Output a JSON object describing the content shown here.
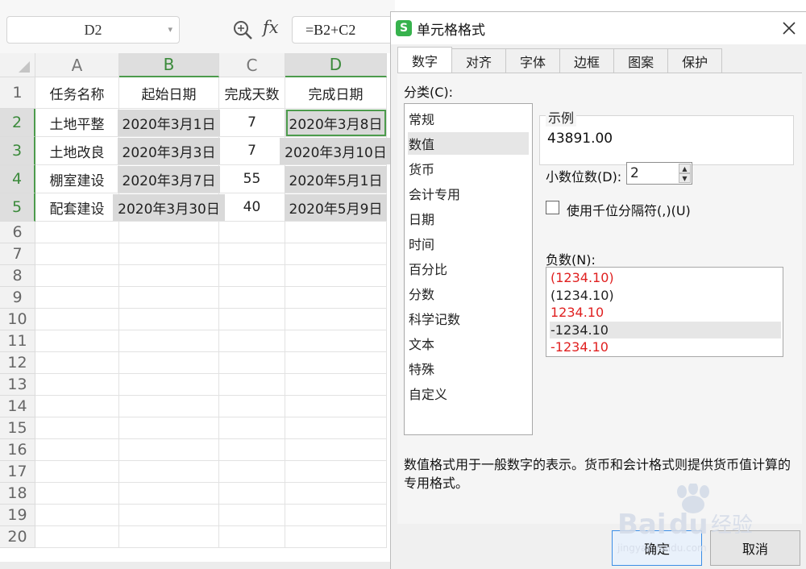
{
  "formula_bar": {
    "name_box": "D2",
    "zoom_icon": "zoom-icon",
    "fx_label": "fx",
    "formula": "=B2+C2"
  },
  "sheet": {
    "columns": [
      "A",
      "B",
      "C",
      "D"
    ],
    "selected_column": "D",
    "rows": [
      {
        "num": "1",
        "cells": [
          "任务名称",
          "起始日期",
          "完成天数",
          "完成日期"
        ]
      },
      {
        "num": "2",
        "cells": [
          "土地平整",
          "2020年3月1日",
          "7",
          "2020年3月8日"
        ]
      },
      {
        "num": "3",
        "cells": [
          "土地改良",
          "2020年3月3日",
          "7",
          "2020年3月10日"
        ]
      },
      {
        "num": "4",
        "cells": [
          "棚室建设",
          "2020年3月7日",
          "55",
          "2020年5月1日"
        ]
      },
      {
        "num": "5",
        "cells": [
          "配套建设",
          "2020年3月30日",
          "40",
          "2020年5月9日"
        ]
      },
      {
        "num": "6",
        "cells": [
          "",
          "",
          "",
          ""
        ]
      },
      {
        "num": "7",
        "cells": [
          "",
          "",
          "",
          ""
        ]
      },
      {
        "num": "8",
        "cells": [
          "",
          "",
          "",
          ""
        ]
      },
      {
        "num": "9",
        "cells": [
          "",
          "",
          "",
          ""
        ]
      },
      {
        "num": "10",
        "cells": [
          "",
          "",
          "",
          ""
        ]
      },
      {
        "num": "11",
        "cells": [
          "",
          "",
          "",
          ""
        ]
      },
      {
        "num": "12",
        "cells": [
          "",
          "",
          "",
          ""
        ]
      },
      {
        "num": "13",
        "cells": [
          "",
          "",
          "",
          ""
        ]
      },
      {
        "num": "14",
        "cells": [
          "",
          "",
          "",
          ""
        ]
      },
      {
        "num": "15",
        "cells": [
          "",
          "",
          "",
          ""
        ]
      },
      {
        "num": "16",
        "cells": [
          "",
          "",
          "",
          ""
        ]
      },
      {
        "num": "17",
        "cells": [
          "",
          "",
          "",
          ""
        ]
      },
      {
        "num": "18",
        "cells": [
          "",
          "",
          "",
          ""
        ]
      },
      {
        "num": "19",
        "cells": [
          "",
          "",
          "",
          ""
        ]
      },
      {
        "num": "20",
        "cells": [
          "",
          "",
          "",
          ""
        ]
      }
    ]
  },
  "dialog": {
    "title": "单元格格式",
    "app_icon_letter": "S",
    "tabs": [
      "数字",
      "对齐",
      "字体",
      "边框",
      "图案",
      "保护"
    ],
    "active_tab": "数字",
    "category_label": "分类(C):",
    "categories": [
      "常规",
      "数值",
      "货币",
      "会计专用",
      "日期",
      "时间",
      "百分比",
      "分数",
      "科学记数",
      "文本",
      "特殊",
      "自定义"
    ],
    "selected_category": "数值",
    "example_label": "示例",
    "example_value": "43891.00",
    "decimal_label": "小数位数(D):",
    "decimal_value": "2",
    "thousands_label": "使用千位分隔符(,)(U)",
    "thousands_checked": false,
    "negative_label": "负数(N):",
    "negative_options": [
      {
        "text": "(1234.10)",
        "red": true
      },
      {
        "text": "(1234.10)",
        "red": false
      },
      {
        "text": "1234.10",
        "red": true
      },
      {
        "text": "-1234.10",
        "red": false
      },
      {
        "text": "-1234.10",
        "red": true
      }
    ],
    "selected_negative": 3,
    "description": "数值格式用于一般数字的表示。货币和会计格式则提供货币值计算的专用格式。",
    "ok_label": "确定",
    "cancel_label": "取消"
  },
  "watermark_text": "Baidu经验 jingyan.baidu.com",
  "colors": {
    "accent_green": "#4c9b4c",
    "selection_gray": "#d9d9d9",
    "negative_red": "#e02020",
    "primary_button_border": "#3a8ee6"
  }
}
